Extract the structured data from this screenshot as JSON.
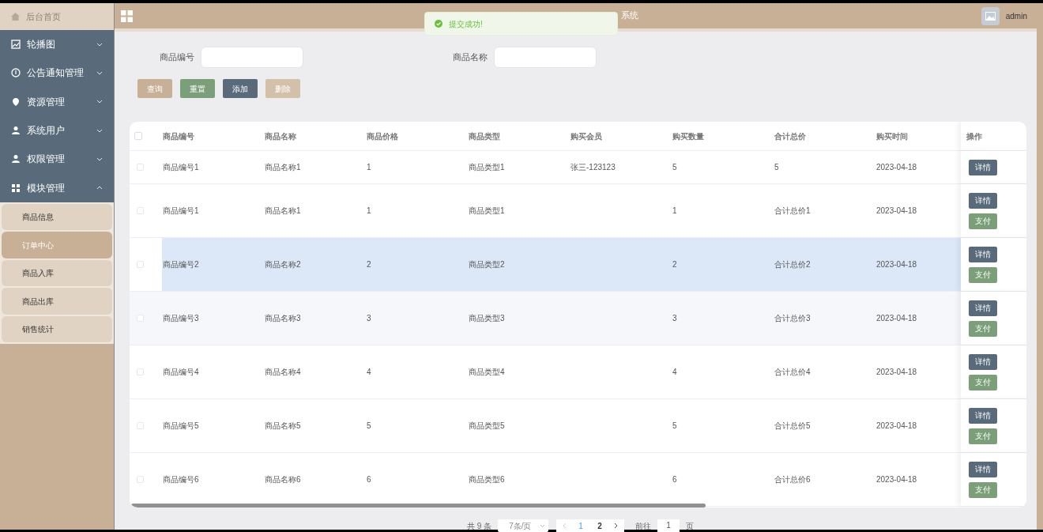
{
  "sidebar": {
    "home": "后台首页",
    "items": [
      {
        "label": "轮播图",
        "expanded": false
      },
      {
        "label": "公告通知管理",
        "expanded": false
      },
      {
        "label": "资源管理",
        "expanded": false
      },
      {
        "label": "系统用户",
        "expanded": false
      },
      {
        "label": "权限管理",
        "expanded": false
      },
      {
        "label": "模块管理",
        "expanded": true,
        "children": [
          {
            "label": "商品信息",
            "selected": false
          },
          {
            "label": "订单中心",
            "selected": true
          },
          {
            "label": "商品入库",
            "selected": false
          },
          {
            "label": "商品出库",
            "selected": false
          },
          {
            "label": "销售统计",
            "selected": false
          }
        ]
      }
    ]
  },
  "header": {
    "title": "系统",
    "user": "admin"
  },
  "toast": {
    "message": "提交成功!"
  },
  "search": {
    "fields": [
      {
        "label": "商品编号"
      },
      {
        "label": "商品名称"
      }
    ],
    "buttons": [
      {
        "kind": "query",
        "label": "查询",
        "disabled": false
      },
      {
        "kind": "reset",
        "label": "重置",
        "disabled": false
      },
      {
        "kind": "add",
        "label": "添加",
        "disabled": false
      },
      {
        "kind": "delete",
        "label": "删除",
        "disabled": true
      }
    ]
  },
  "table": {
    "select_all_checked": false,
    "columns": [
      "商品编号",
      "商品名称",
      "商品价格",
      "商品类型",
      "购买会员",
      "购买数量",
      "合计总价",
      "购买时间",
      "操作"
    ],
    "rows": [
      {
        "cells": [
          "商品编号1",
          "商品名称1",
          "1",
          "商品类型1",
          "张三-123123",
          "5",
          "5",
          "2023-04-18"
        ],
        "actions": [
          "详情"
        ],
        "highlighted": false,
        "checked": false
      },
      {
        "cells": [
          "商品编号1",
          "商品名称1",
          "1",
          "商品类型1",
          "",
          "1",
          "合计总价1",
          "2023-04-18"
        ],
        "actions": [
          "详情",
          "支付"
        ],
        "highlighted": false,
        "checked": false
      },
      {
        "cells": [
          "商品编号2",
          "商品名称2",
          "2",
          "商品类型2",
          "",
          "2",
          "合计总价2",
          "2023-04-18"
        ],
        "actions": [
          "详情",
          "支付"
        ],
        "highlighted": true,
        "checked": false
      },
      {
        "cells": [
          "商品编号3",
          "商品名称3",
          "3",
          "商品类型3",
          "",
          "3",
          "合计总价3",
          "2023-04-18"
        ],
        "actions": [
          "详情",
          "支付"
        ],
        "highlighted": false,
        "checked": false
      },
      {
        "cells": [
          "商品编号4",
          "商品名称4",
          "4",
          "商品类型4",
          "",
          "4",
          "合计总价4",
          "2023-04-18"
        ],
        "actions": [
          "详情",
          "支付"
        ],
        "highlighted": false,
        "checked": false
      },
      {
        "cells": [
          "商品编号5",
          "商品名称5",
          "5",
          "商品类型5",
          "",
          "5",
          "合计总价5",
          "2023-04-18"
        ],
        "actions": [
          "详情",
          "支付"
        ],
        "highlighted": false,
        "checked": false
      },
      {
        "cells": [
          "商品编号6",
          "商品名称6",
          "6",
          "商品类型6",
          "",
          "6",
          "合计总价6",
          "2023-04-18"
        ],
        "actions": [
          "详情",
          "支付"
        ],
        "highlighted": false,
        "checked": false
      }
    ]
  },
  "pagination": {
    "total": "共 9 条",
    "page_size": "7条/页",
    "pages": [
      {
        "label": "1",
        "selected": true
      },
      {
        "label": "2",
        "selected": false
      }
    ],
    "goto_label": "前往",
    "goto_value": "1",
    "goto_suffix": "页"
  }
}
